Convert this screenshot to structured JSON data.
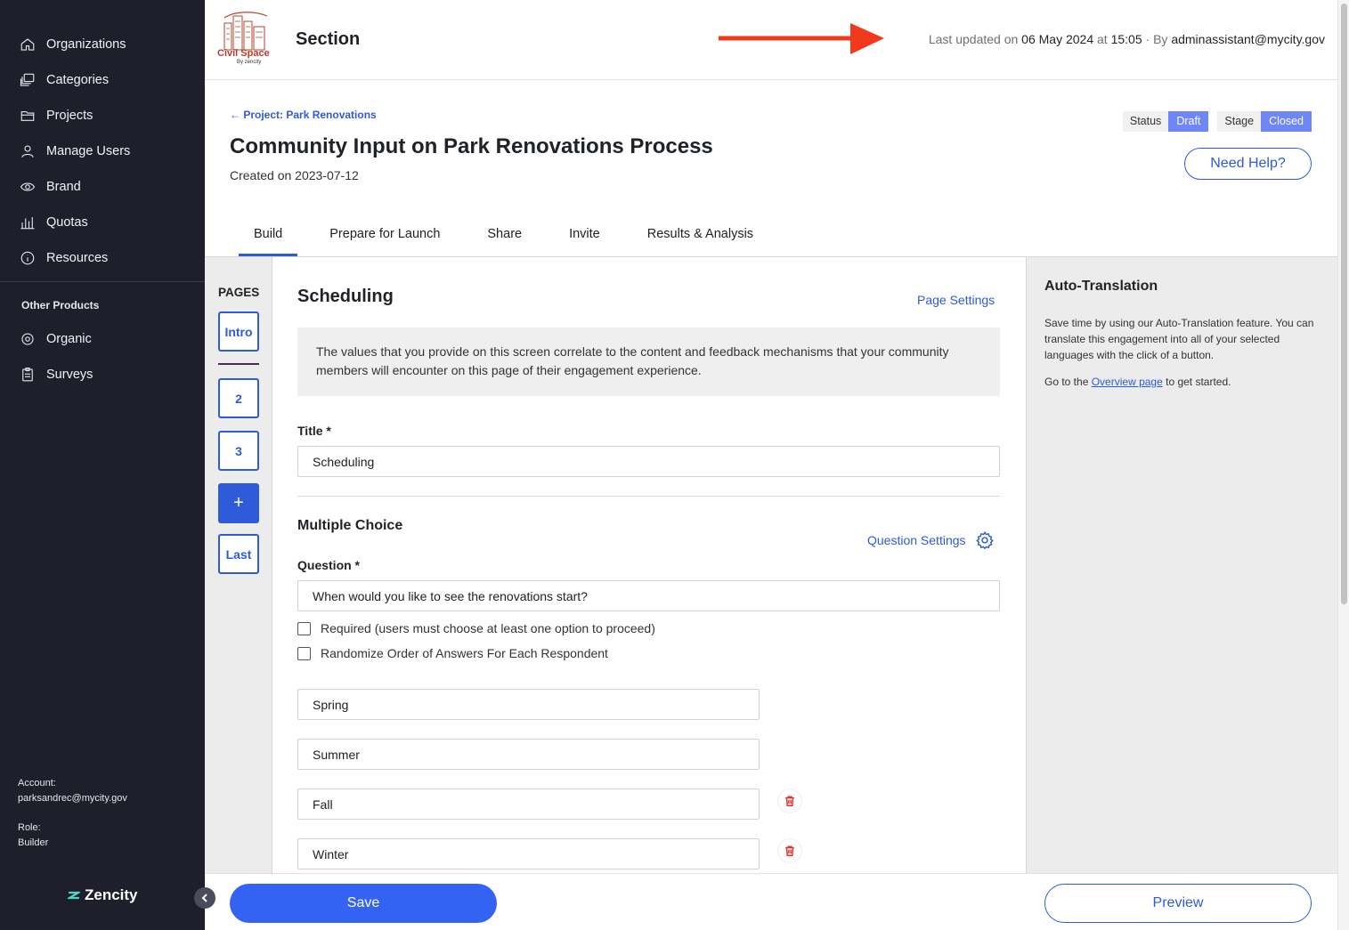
{
  "sidebar": {
    "nav": [
      {
        "label": "Organizations",
        "icon": "home-icon"
      },
      {
        "label": "Categories",
        "icon": "layers-icon"
      },
      {
        "label": "Projects",
        "icon": "folder-icon"
      },
      {
        "label": "Manage Users",
        "icon": "user-icon"
      },
      {
        "label": "Brand",
        "icon": "eye-icon"
      },
      {
        "label": "Quotas",
        "icon": "bar-chart-icon"
      },
      {
        "label": "Resources",
        "icon": "info-icon"
      }
    ],
    "other_title": "Other Products",
    "other": [
      {
        "label": "Organic",
        "icon": "target-icon"
      },
      {
        "label": "Surveys",
        "icon": "clipboard-icon"
      }
    ],
    "account_label": "Account:",
    "account_value": "parksandrec@mycity.gov",
    "role_label": "Role:",
    "role_value": "Builder",
    "brand": "Zencity"
  },
  "header": {
    "logo_text": "Civil Space",
    "logo_sub": "By zencity",
    "title": "Section",
    "updated_prefix": "Last updated on",
    "updated_date": "06 May 2024",
    "updated_at": "at",
    "updated_time": "15:05",
    "updated_by_prefix": "· By",
    "updated_by": "adminassistant@mycity.gov",
    "arrow_color": "#f03a1b"
  },
  "project": {
    "back_link": "← Project: Park Renovations",
    "title": "Community Input on Park Renovations Process",
    "created": "Created on 2023-07-12",
    "status_label": "Status",
    "status_value": "Draft",
    "stage_label": "Stage",
    "stage_value": "Closed",
    "help": "Need Help?"
  },
  "tabs": [
    "Build",
    "Prepare for Launch",
    "Share",
    "Invite",
    "Results & Analysis"
  ],
  "pages": {
    "label": "PAGES",
    "items": [
      "Intro",
      "2",
      "3",
      "+",
      "Last"
    ]
  },
  "editor": {
    "heading": "Scheduling",
    "page_settings": "Page Settings",
    "info": "The values that you provide on this screen correlate to the content and feedback mechanisms that your community members will encounter on this page of their engagement experience.",
    "title_label": "Title *",
    "title_value": "Scheduling",
    "mc_heading": "Multiple Choice",
    "question_settings": "Question Settings",
    "question_label": "Question *",
    "question_value": "When would you like to see the renovations start?",
    "required_label": "Required (users must choose at least one option to proceed)",
    "randomize_label": "Randomize Order of Answers For Each Respondent",
    "options": [
      "Spring",
      "Summer",
      "Fall",
      "Winter"
    ]
  },
  "right_panel": {
    "title": "Auto-Translation",
    "text": "Save time by using our Auto-Translation feature. You can translate this engagement into all of your selected languages with the click of a button.",
    "go_prefix": "Go to the",
    "go_link": "Overview page",
    "go_suffix": "to get started."
  },
  "footer": {
    "save": "Save",
    "preview": "Preview"
  },
  "colors": {
    "sidebar_bg": "#1e1f2b",
    "accent": "#2e5bd9",
    "badge": "#6f86f6",
    "delete": "#e03131"
  }
}
